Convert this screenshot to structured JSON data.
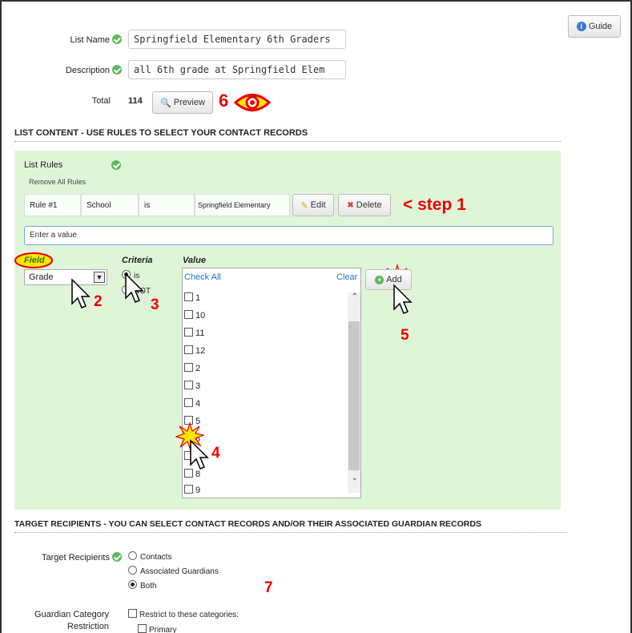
{
  "header": {
    "guide_label": "Guide",
    "list_name_label": "List Name",
    "list_name_value": "Springfield Elementary 6th Graders",
    "description_label": "Description",
    "description_value": "all 6th grade at Springfield Elem",
    "total_label": "Total",
    "total_value": "114",
    "preview_label": "Preview"
  },
  "list_content": {
    "heading": "LIST CONTENT - USE RULES TO SELECT YOUR CONTACT RECORDS",
    "list_rules_label": "List Rules",
    "remove_all_label": "Remove All Rules",
    "rule": {
      "number": "Rule #1",
      "field": "School",
      "operator": "is",
      "value": "Springfield Elementary",
      "edit_label": "Edit",
      "delete_label": "Delete"
    },
    "value_input_placeholder": "Enter a value",
    "field_header": "Field",
    "field_selected": "Grade",
    "criteria_header": "Criteria",
    "criteria_options": [
      "is",
      "NOT"
    ],
    "value_header": "Value",
    "check_all_label": "Check All",
    "clear_label": "Clear",
    "add_label": "Add",
    "values": [
      {
        "label": "1",
        "checked": false
      },
      {
        "label": "10",
        "checked": false
      },
      {
        "label": "11",
        "checked": false
      },
      {
        "label": "12",
        "checked": false
      },
      {
        "label": "2",
        "checked": false
      },
      {
        "label": "3",
        "checked": false
      },
      {
        "label": "4",
        "checked": false
      },
      {
        "label": "5",
        "checked": false
      },
      {
        "label": "6",
        "checked": true
      },
      {
        "label": "7",
        "checked": false
      },
      {
        "label": "8",
        "checked": false
      },
      {
        "label": "9",
        "checked": false
      }
    ]
  },
  "target": {
    "heading": "TARGET RECIPIENTS - YOU CAN SELECT CONTACT RECORDS AND/OR THEIR ASSOCIATED GUARDIAN RECORDS",
    "label": "Target Recipients",
    "options": [
      "Contacts",
      "Associated Guardians",
      "Both"
    ],
    "selected": "Both",
    "guardian_label_line1": "Guardian Category",
    "guardian_label_line2": "Restriction",
    "restrict_label": "Restrict to these categories:",
    "primary_label": "Primary"
  },
  "annotations": {
    "step1": "< step 1",
    "n2": "2",
    "n3": "3",
    "n4": "4",
    "n5": "5",
    "n6": "6",
    "n7": "7"
  },
  "colors": {
    "panel_green": "#dff5d8",
    "annotation_red": "#e00000",
    "link_blue": "#1a73c8",
    "ok_green": "#5cb85c"
  }
}
